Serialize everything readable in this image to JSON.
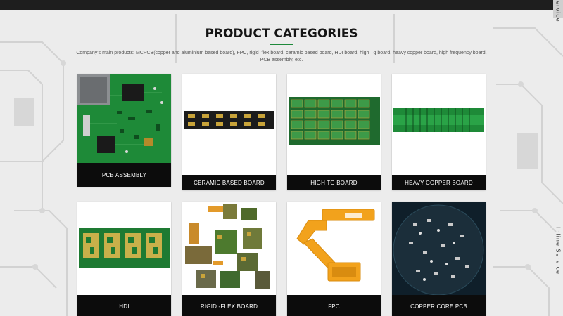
{
  "side_tab": {
    "top_label": "Service",
    "mid_label": "Inline Service"
  },
  "section": {
    "title": "PRODUCT CATEGORIES",
    "description": "Company's main products: MCPCB(copper and aluminium based board), FPC, rigid_flex board, ceramic based board, HDI board, high Tg board, heavy copper board, high frequency board, PCB assembly, etc."
  },
  "colors": {
    "accent": "#1f8a3c",
    "label_bg": "#0c0c0c",
    "pcb_green": "#1f8a3c",
    "flex_orange": "#f2a21c"
  },
  "categories": [
    {
      "label": "PCB ASSEMBLY",
      "image": "pcb-assembly-image"
    },
    {
      "label": "CERAMIC BASED BOARD",
      "image": "ceramic-board-image"
    },
    {
      "label": "HIGH TG BOARD",
      "image": "high-tg-board-image"
    },
    {
      "label": "HEAVY COPPER BOARD",
      "image": "heavy-copper-board-image"
    },
    {
      "label": "HDI",
      "image": "hdi-board-image"
    },
    {
      "label": "RIGID -FLEX BOARD",
      "image": "rigid-flex-board-image"
    },
    {
      "label": "FPC",
      "image": "fpc-image"
    },
    {
      "label": "COPPER CORE PCB",
      "image": "copper-core-pcb-image"
    }
  ]
}
